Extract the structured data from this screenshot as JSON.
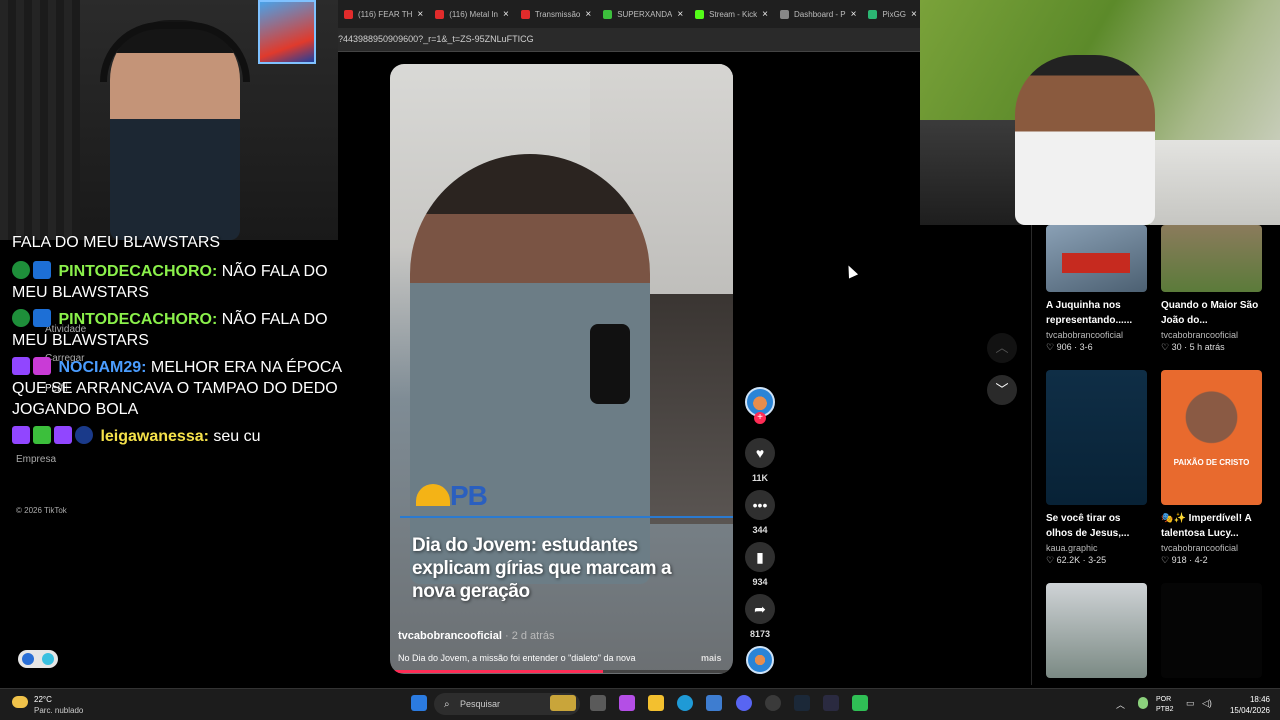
{
  "browser": {
    "tabs": [
      {
        "title": "(116) FEAR TH",
        "color": "#e12b2b"
      },
      {
        "title": "(116) Metal In",
        "color": "#e12b2b"
      },
      {
        "title": "Transmissão",
        "color": "#e12b2b"
      },
      {
        "title": "SUPERXANDA",
        "color": "#3cbf3c"
      },
      {
        "title": "Stream - Kick",
        "color": "#53fc18"
      },
      {
        "title": "Dashboard - P",
        "color": "#888888"
      },
      {
        "title": "PixGG",
        "color": "#2bb673"
      }
    ],
    "url": "?443988950909600?_r=1&_t=ZS-95ZNLuFTICG"
  },
  "tiktok_sidebar_ghost": [
    "Atividade",
    "Carregar",
    "Perfil",
    "Empresa"
  ],
  "chat": [
    {
      "user": "",
      "text": "FALA DO MEU BLAWSTARS",
      "color": "#ffffff"
    },
    {
      "user": "PINTODECACHORO:",
      "text": "NÃO FALA DO MEU BLAWSTARS",
      "color": "#8bf14b"
    },
    {
      "user": "PINTODECACHORO:",
      "text": "NÃO FALA DO MEU BLAWSTARS",
      "color": "#8bf14b"
    },
    {
      "user": "NOCIAM29:",
      "text": "MELHOR ERA NA ÉPOCA QUE SE ARRANCAVA O TAMPAO DO DEDO JOGANDO BOLA",
      "color": "#4b9dff"
    },
    {
      "user": "leigawanessa:",
      "text": "seu cu",
      "color": "#f5e14a"
    }
  ],
  "copyright": "© 2026 TikTok",
  "video": {
    "headline": "Dia do Jovem: estudantes explicam gírias que marcam a nova geração",
    "logo_text": "PB",
    "author": "tvcabobrancooficial",
    "time": " · 2 d atrás",
    "description": "No Dia do Jovem, a missão foi entender o \"dialeto\" da nova",
    "more": "mais",
    "progress": 0.62
  },
  "actions": {
    "likes": "11K",
    "comments": "344",
    "saves": "934",
    "shares": "8173"
  },
  "grid": [
    {
      "title": "A Juquinha nos representando......",
      "author": "tvcabobrancooficial",
      "stats": "♡ 906 · 3-6"
    },
    {
      "title": "Quando o Maior São João do...",
      "author": "tvcabobrancooficial",
      "stats": "♡ 30 · 5 h atrás"
    },
    {
      "title": "Se você tirar os olhos de Jesus,...",
      "author": "kaua.graphic",
      "stats": "♡ 62.2K · 3-25"
    },
    {
      "title": "🎭✨ Imperdível! A talentosa Lucy...",
      "author": "tvcabobrancooficial",
      "stats": "♡ 918 · 4-2",
      "overlay": "PAIXÃO DE CRISTO"
    }
  ],
  "taskbar": {
    "temp": "22°C",
    "weather": "Parc. nublado",
    "search_placeholder": "Pesquisar",
    "lang": "POR",
    "layout": "PTB2",
    "time": "18:46",
    "date": "15/04/2026"
  }
}
